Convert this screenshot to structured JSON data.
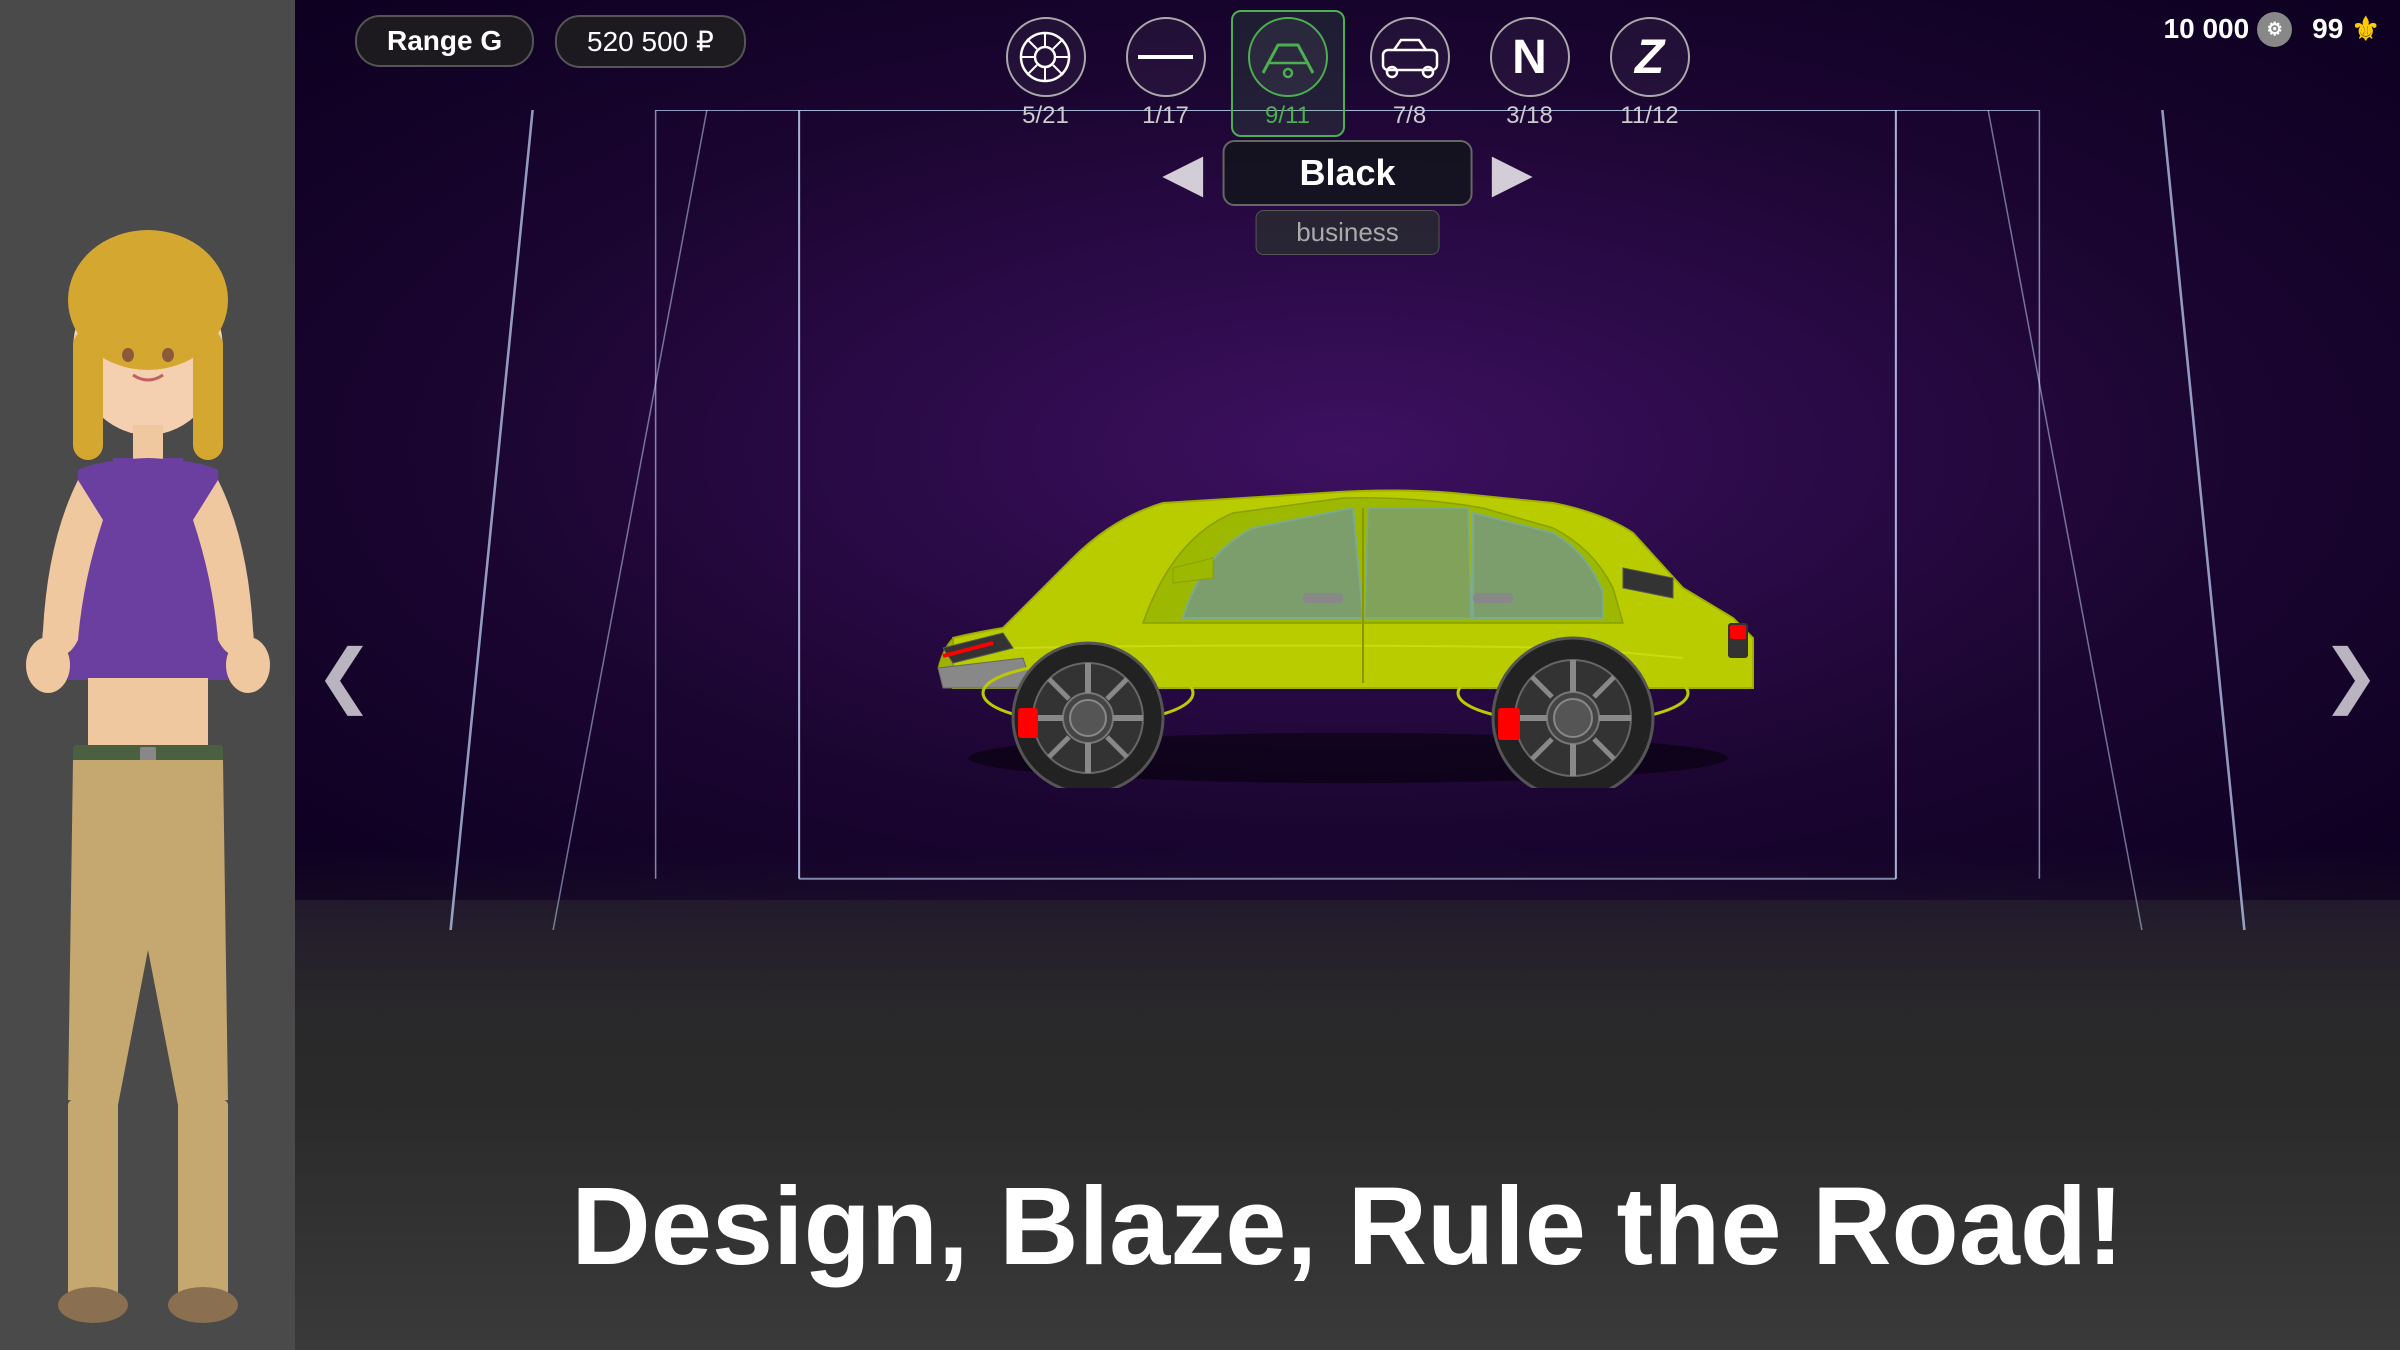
{
  "header": {
    "car_name": "Range G",
    "price": "520 500 ₽",
    "currency_coins": "10 000",
    "currency_gems": "99"
  },
  "tabs": [
    {
      "id": "wheels",
      "icon": "wheel",
      "count": "5/21",
      "active": false
    },
    {
      "id": "stripe",
      "icon": "stripe",
      "count": "1/17",
      "active": false
    },
    {
      "id": "roof",
      "icon": "roof",
      "count": "9/11",
      "active": true
    },
    {
      "id": "body",
      "icon": "body",
      "count": "7/8",
      "active": false
    },
    {
      "id": "n-icon",
      "icon": "n",
      "count": "3/18",
      "active": false
    },
    {
      "id": "z-icon",
      "icon": "z",
      "count": "11/12",
      "active": false
    }
  ],
  "color_selector": {
    "color_name": "Black",
    "color_subtype": "business",
    "arrow_left": "◀",
    "arrow_right": "▶"
  },
  "navigation": {
    "arrow_left": "❮",
    "arrow_right": "❯"
  },
  "tagline": "Design, Blaze, Rule the Road!"
}
